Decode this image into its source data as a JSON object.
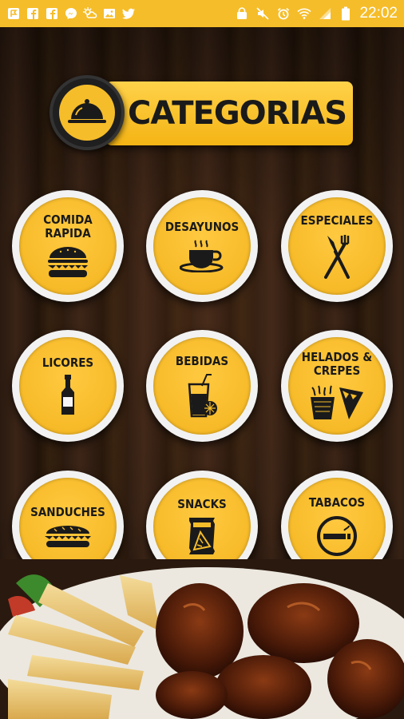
{
  "status_bar": {
    "left_icons": [
      "flag-notification-icon",
      "facebook-icon",
      "facebook-square-icon",
      "messenger-icon",
      "weather-icon",
      "gallery-icon",
      "twitter-icon"
    ],
    "right_icons": [
      "lock-icon",
      "mute-icon",
      "alarm-icon",
      "wifi-icon",
      "signal-icon",
      "battery-icon"
    ],
    "time": "22:02"
  },
  "title": {
    "text": "CATEGORIAS",
    "icon": "serving-cloche-icon"
  },
  "categories": [
    {
      "label": "COMIDA\nRAPIDA",
      "icon": "burger-icon"
    },
    {
      "label": "DESAYUNOS",
      "icon": "coffee-cup-icon"
    },
    {
      "label": "ESPECIALES",
      "icon": "fork-knife-icon"
    },
    {
      "label": "LICORES",
      "icon": "liquor-bottle-icon"
    },
    {
      "label": "BEBIDAS",
      "icon": "drink-glass-icon"
    },
    {
      "label": "HELADOS &\nCREPES",
      "icon": "ice-cream-crepe-icon"
    },
    {
      "label": "SANDUCHES",
      "icon": "sandwich-icon"
    },
    {
      "label": "SNACKS",
      "icon": "snack-bag-icon"
    },
    {
      "label": "TABACOS",
      "icon": "cigarette-icon"
    }
  ],
  "colors": {
    "accent": "#f6bd2a",
    "dark": "#1a1a1a",
    "ring": "#f2f2f2"
  }
}
